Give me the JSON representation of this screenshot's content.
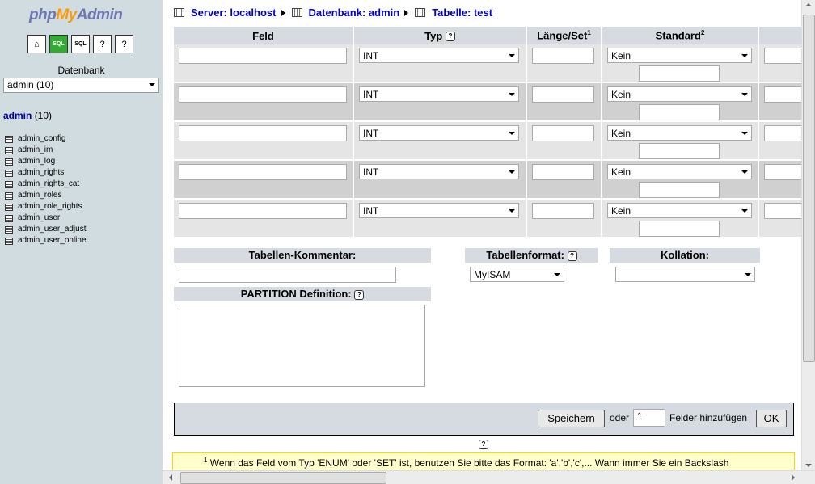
{
  "sidebar": {
    "logo": {
      "php": "php",
      "my": "My",
      "admin": "Admin"
    },
    "icons": [
      "home-icon",
      "sql-query-icon",
      "sql-icon",
      "help-docs-icon",
      "sql-docs-icon"
    ],
    "db_label": "Datenbank",
    "db_select_value": "admin (10)",
    "db_title_name": "admin",
    "db_title_count": "(10)",
    "tables": [
      "admin_config",
      "admin_im",
      "admin_log",
      "admin_rights",
      "admin_rights_cat",
      "admin_roles",
      "admin_role_rights",
      "admin_user",
      "admin_user_adjust",
      "admin_user_online"
    ]
  },
  "breadcrumb": {
    "server": "Server: localhost",
    "database": "Datenbank: admin",
    "table": "Tabelle: test"
  },
  "fields_table": {
    "headers": {
      "feld": "Feld",
      "typ": "Typ",
      "laenge": "Länge/Set",
      "laenge_sup": "1",
      "standard": "Standard",
      "standard_sup": "2"
    },
    "rows": [
      {
        "name": "",
        "type": "INT",
        "length": "",
        "default": "Kein",
        "default_value": ""
      },
      {
        "name": "",
        "type": "INT",
        "length": "",
        "default": "Kein",
        "default_value": ""
      },
      {
        "name": "",
        "type": "INT",
        "length": "",
        "default": "Kein",
        "default_value": ""
      },
      {
        "name": "",
        "type": "INT",
        "length": "",
        "default": "Kein",
        "default_value": ""
      },
      {
        "name": "",
        "type": "INT",
        "length": "",
        "default": "Kein",
        "default_value": ""
      }
    ]
  },
  "options": {
    "comment_label": "Tabellen-Kommentar:",
    "comment_value": "",
    "format_label": "Tabellenformat:",
    "format_value": "MyISAM",
    "collation_label": "Kollation:",
    "collation_value": "",
    "partition_label": "PARTITION Definition:",
    "partition_value": ""
  },
  "footer": {
    "save_label": "Speichern",
    "or_label": "oder",
    "add_count": "1",
    "add_label": "Felder hinzufügen",
    "ok_label": "OK"
  },
  "note": {
    "sup": "1",
    "text": "Wenn das Feld vom Typ 'ENUM' oder 'SET' ist, benutzen Sie bitte das Format: 'a','b','c',... Wann immer Sie ein Backslash"
  },
  "colors": {
    "sidebar_bg": "#d0dce0",
    "header_bg": "#d5dbe0",
    "row_odd": "#e5e5e5",
    "row_even": "#d0d0d0",
    "link": "#0000cc",
    "note_bg": "#ffffcc"
  }
}
